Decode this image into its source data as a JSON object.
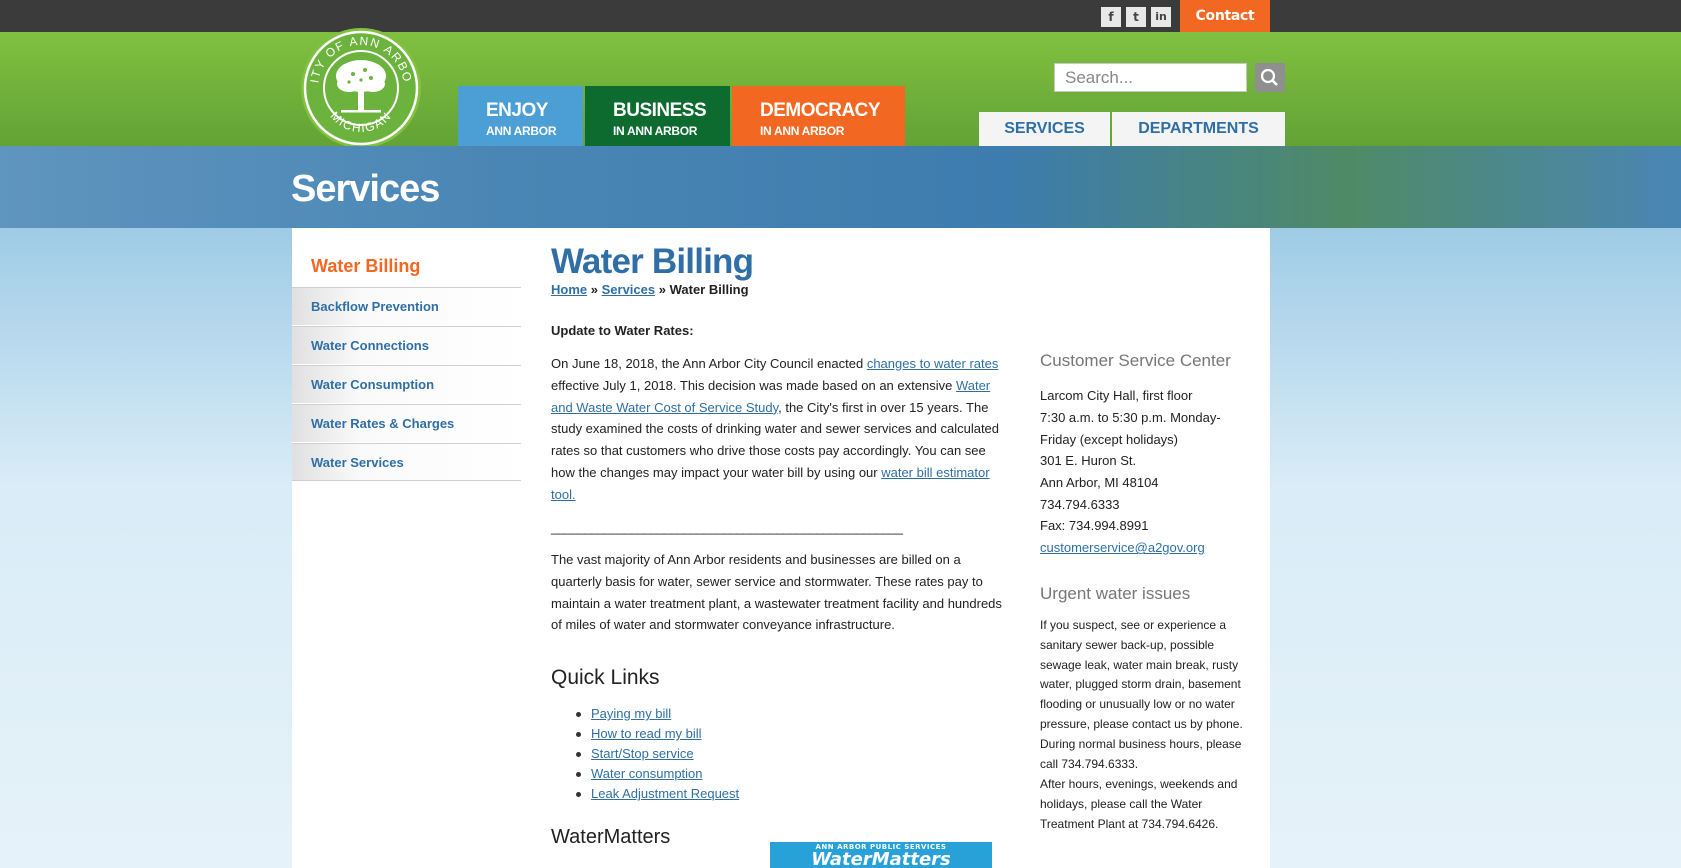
{
  "topbar": {
    "social": [
      {
        "label": "f",
        "icon": "facebook-icon"
      },
      {
        "label": "t",
        "icon": "twitter-icon"
      },
      {
        "label": "in",
        "icon": "linkedin-icon"
      }
    ],
    "contact_label": "Contact"
  },
  "logo": {
    "text_top": "CITY OF ANN ARBOR",
    "text_bottom": "MICHIGAN"
  },
  "nav": [
    {
      "big": "ENJOY",
      "small": "ANN ARBOR",
      "color": "#4b9fd5"
    },
    {
      "big": "BUSINESS",
      "small": "IN ANN ARBOR",
      "color": "#0e6b2f"
    },
    {
      "big": "DEMOCRACY",
      "small": "IN ANN ARBOR",
      "color": "#f26722"
    }
  ],
  "search": {
    "placeholder": "Search..."
  },
  "subnav": [
    "SERVICES",
    "DEPARTMENTS"
  ],
  "banner": {
    "title": "Services"
  },
  "sidebar": {
    "title": "Water Billing",
    "items": [
      "Backflow Prevention",
      "Water Connections",
      "Water Consumption",
      "Water Rates & Charges",
      "Water Services"
    ]
  },
  "page": {
    "title": "Water Billing",
    "breadcrumb": {
      "home": "Home",
      "services": "Services",
      "sep": "»",
      "current": "Water Billing"
    },
    "update_heading": "Update to Water Rates:",
    "para1": {
      "t1": "On June 18, 2018, the Ann Arbor City Council enacted ",
      "link1": "changes to water rates",
      "t2": " effective July 1, 2018. This decision was made based on an extensive ",
      "link2": "Water and Waste Water Cost of Service Study",
      "t3": ", the City's first in over 15 years. The study examined the costs of drinking water and sewer services and calculated rates so that customers who drive those costs pay accordingly. You can see how the changes may impact your water bill by using our ",
      "link3": "water bill estimator tool. "
    },
    "divider": "_____________________________________________________",
    "para2": "The vast majority of Ann Arbor residents and businesses are billed on a quarterly basis for water, sewer service and stormwater. These rates pay to maintain a water treatment plant, a wastewater treatment facility and hundreds of miles of water and stormwater conveyance infrastructure.",
    "quick_links_heading": "Quick Links",
    "quick_links": [
      "Paying my bill",
      "How to read my bill",
      "Start/Stop service",
      "Water consumption",
      "Leak Adjustment Request"
    ],
    "watermatters_heading": "WaterMatters",
    "watermatters_image_text": "WaterMatters",
    "watermatters_image_top": "ANN ARBOR PUBLIC SERVICES"
  },
  "right": {
    "csc_heading": "Customer Service Center",
    "csc_lines1": [
      "Larcom City Hall, first floor",
      "7:30 a.m. to 5:30 p.m. Monday-Friday (except holidays)"
    ],
    "address": [
      "301 E. Huron St.",
      "Ann Arbor, MI 48104",
      "734.794.6333",
      "Fax: 734.994.8991"
    ],
    "email": "customerservice@a2gov.org",
    "urgent_heading": "Urgent water issues",
    "urgent_para1": "If you suspect, see or experience a sanitary sewer back-up, possible sewage leak, water main break, rusty water, plugged storm drain, basement flooding or unusually low or no water pressure, please contact us by phone. During normal business hours, please call 734.794.6333.",
    "urgent_para2": "After hours, evenings, weekends and holidays, please call the Water Treatment Plant at 734.794.6426."
  }
}
